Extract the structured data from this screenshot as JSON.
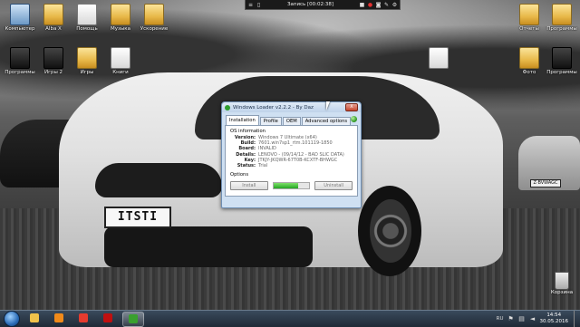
{
  "desktop": {
    "icons_left": [
      {
        "label": "Компьютер",
        "kind": "computer",
        "col": 0,
        "row": 0
      },
      {
        "label": "Alba X",
        "kind": "folder",
        "col": 1,
        "row": 0
      },
      {
        "label": "Помощь",
        "kind": "doc",
        "col": 2,
        "row": 0
      },
      {
        "label": "Музыка",
        "kind": "folder",
        "col": 3,
        "row": 0
      },
      {
        "label": "Ускорение",
        "kind": "folder",
        "col": 4,
        "row": 0
      },
      {
        "label": "Программы",
        "kind": "dark",
        "col": 0,
        "row": 1
      },
      {
        "label": "Игры 2",
        "kind": "dark",
        "col": 1,
        "row": 1
      },
      {
        "label": "Игры",
        "kind": "folder",
        "col": 2,
        "row": 1
      },
      {
        "label": "Книги",
        "kind": "doc",
        "col": 3,
        "row": 1
      }
    ],
    "icons_right": [
      {
        "label": "Отчеты",
        "kind": "folder"
      },
      {
        "label": "Программы",
        "kind": "folder"
      },
      {
        "label": "",
        "kind": "doc"
      },
      {
        "label": "Фото",
        "kind": "folder"
      },
      {
        "label": "Программы",
        "kind": "dark"
      }
    ],
    "recycle_bin": "Корзина",
    "car_plate": "ITSTI",
    "right_car_plate": "Z·BVWAGC"
  },
  "recorder": {
    "title": "Запись [00:02:38]",
    "icons": [
      "menu-icon",
      "pause-icon",
      "stop-icon",
      "record-icon",
      "camera-icon",
      "pencil-icon",
      "settings-icon"
    ]
  },
  "loader_window": {
    "title": "Windows Loader v2.2.2 - By Daz",
    "close_label": "X",
    "tabs": [
      "Installation",
      "Profile",
      "OEM",
      "Advanced options"
    ],
    "active_tab": "Installation",
    "section_os": "OS information",
    "fields": [
      {
        "key": "Version:",
        "value": "Windows 7 Ultimate (x64)"
      },
      {
        "key": "Build:",
        "value": "7601.win7sp1_rtm.101119-1850"
      },
      {
        "key": "Board:",
        "value": "INVALID"
      },
      {
        "key": "Details:",
        "value": "LENOVO - (09/14/12 - BAD SLIC DATA)"
      },
      {
        "key": "Key:",
        "value": "JTKJY-JKQWR-67T0B-KCXTF-BHWGC"
      },
      {
        "key": "Status:",
        "value": "Trial"
      }
    ],
    "section_options": "Options",
    "install_label": "Install",
    "uninstall_label": "Uninstall",
    "progress": 0.7,
    "status_color": "#3aa02e"
  },
  "taskbar": {
    "apps": [
      {
        "name": "explorer",
        "color": "#f0c24a",
        "active": false
      },
      {
        "name": "media-player",
        "color": "#f08a1a",
        "active": false
      },
      {
        "name": "yandex-browser",
        "color": "#e63b2e",
        "active": false
      },
      {
        "name": "recorder",
        "color": "#c01010",
        "active": false
      },
      {
        "name": "windows-loader",
        "color": "#3aa02e",
        "active": true
      }
    ],
    "language": "RU",
    "time": "14:54",
    "date": "30.05.2016"
  }
}
